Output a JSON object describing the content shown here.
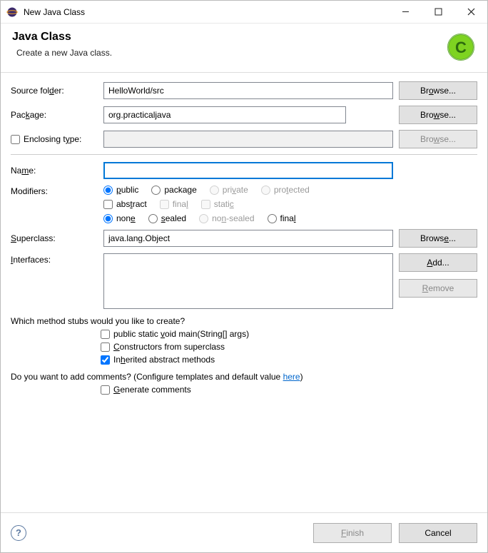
{
  "window": {
    "title": "New Java Class"
  },
  "banner": {
    "heading": "Java Class",
    "subtitle": "Create a new Java class."
  },
  "form": {
    "sourceFolder": {
      "label": "Source folder:",
      "value": "HelloWorld/src",
      "browse": "Browse..."
    },
    "package": {
      "label": "Package:",
      "value": "org.practicaljava",
      "browse": "Browse..."
    },
    "enclosing": {
      "label": "Enclosing type:",
      "value": "",
      "browse": "Browse...",
      "checked": false
    },
    "name": {
      "label": "Name:",
      "value": ""
    },
    "modifiers": {
      "label": "Modifiers:",
      "visibility": {
        "public": "public",
        "package": "package",
        "private": "private",
        "protected": "protected",
        "selected": "public"
      },
      "flags": {
        "abstract": "abstract",
        "final": "final",
        "static": "static"
      },
      "seal": {
        "none": "none",
        "sealed": "sealed",
        "nonsealed": "non-sealed",
        "final": "final",
        "selected": "none"
      }
    },
    "superclass": {
      "label": "Superclass:",
      "value": "java.lang.Object",
      "browse": "Browse..."
    },
    "interfaces": {
      "label": "Interfaces:",
      "add": "Add...",
      "remove": "Remove"
    }
  },
  "stubs": {
    "question": "Which method stubs would you like to create?",
    "main": "public static void main(String[] args)",
    "constructors": "Constructors from superclass",
    "inherited": "Inherited abstract methods",
    "inheritedChecked": true
  },
  "comments": {
    "question_prefix": "Do you want to add comments? (Configure templates and default value ",
    "link": "here",
    "question_suffix": ")",
    "generate": "Generate comments"
  },
  "footer": {
    "finish": "Finish",
    "cancel": "Cancel"
  }
}
